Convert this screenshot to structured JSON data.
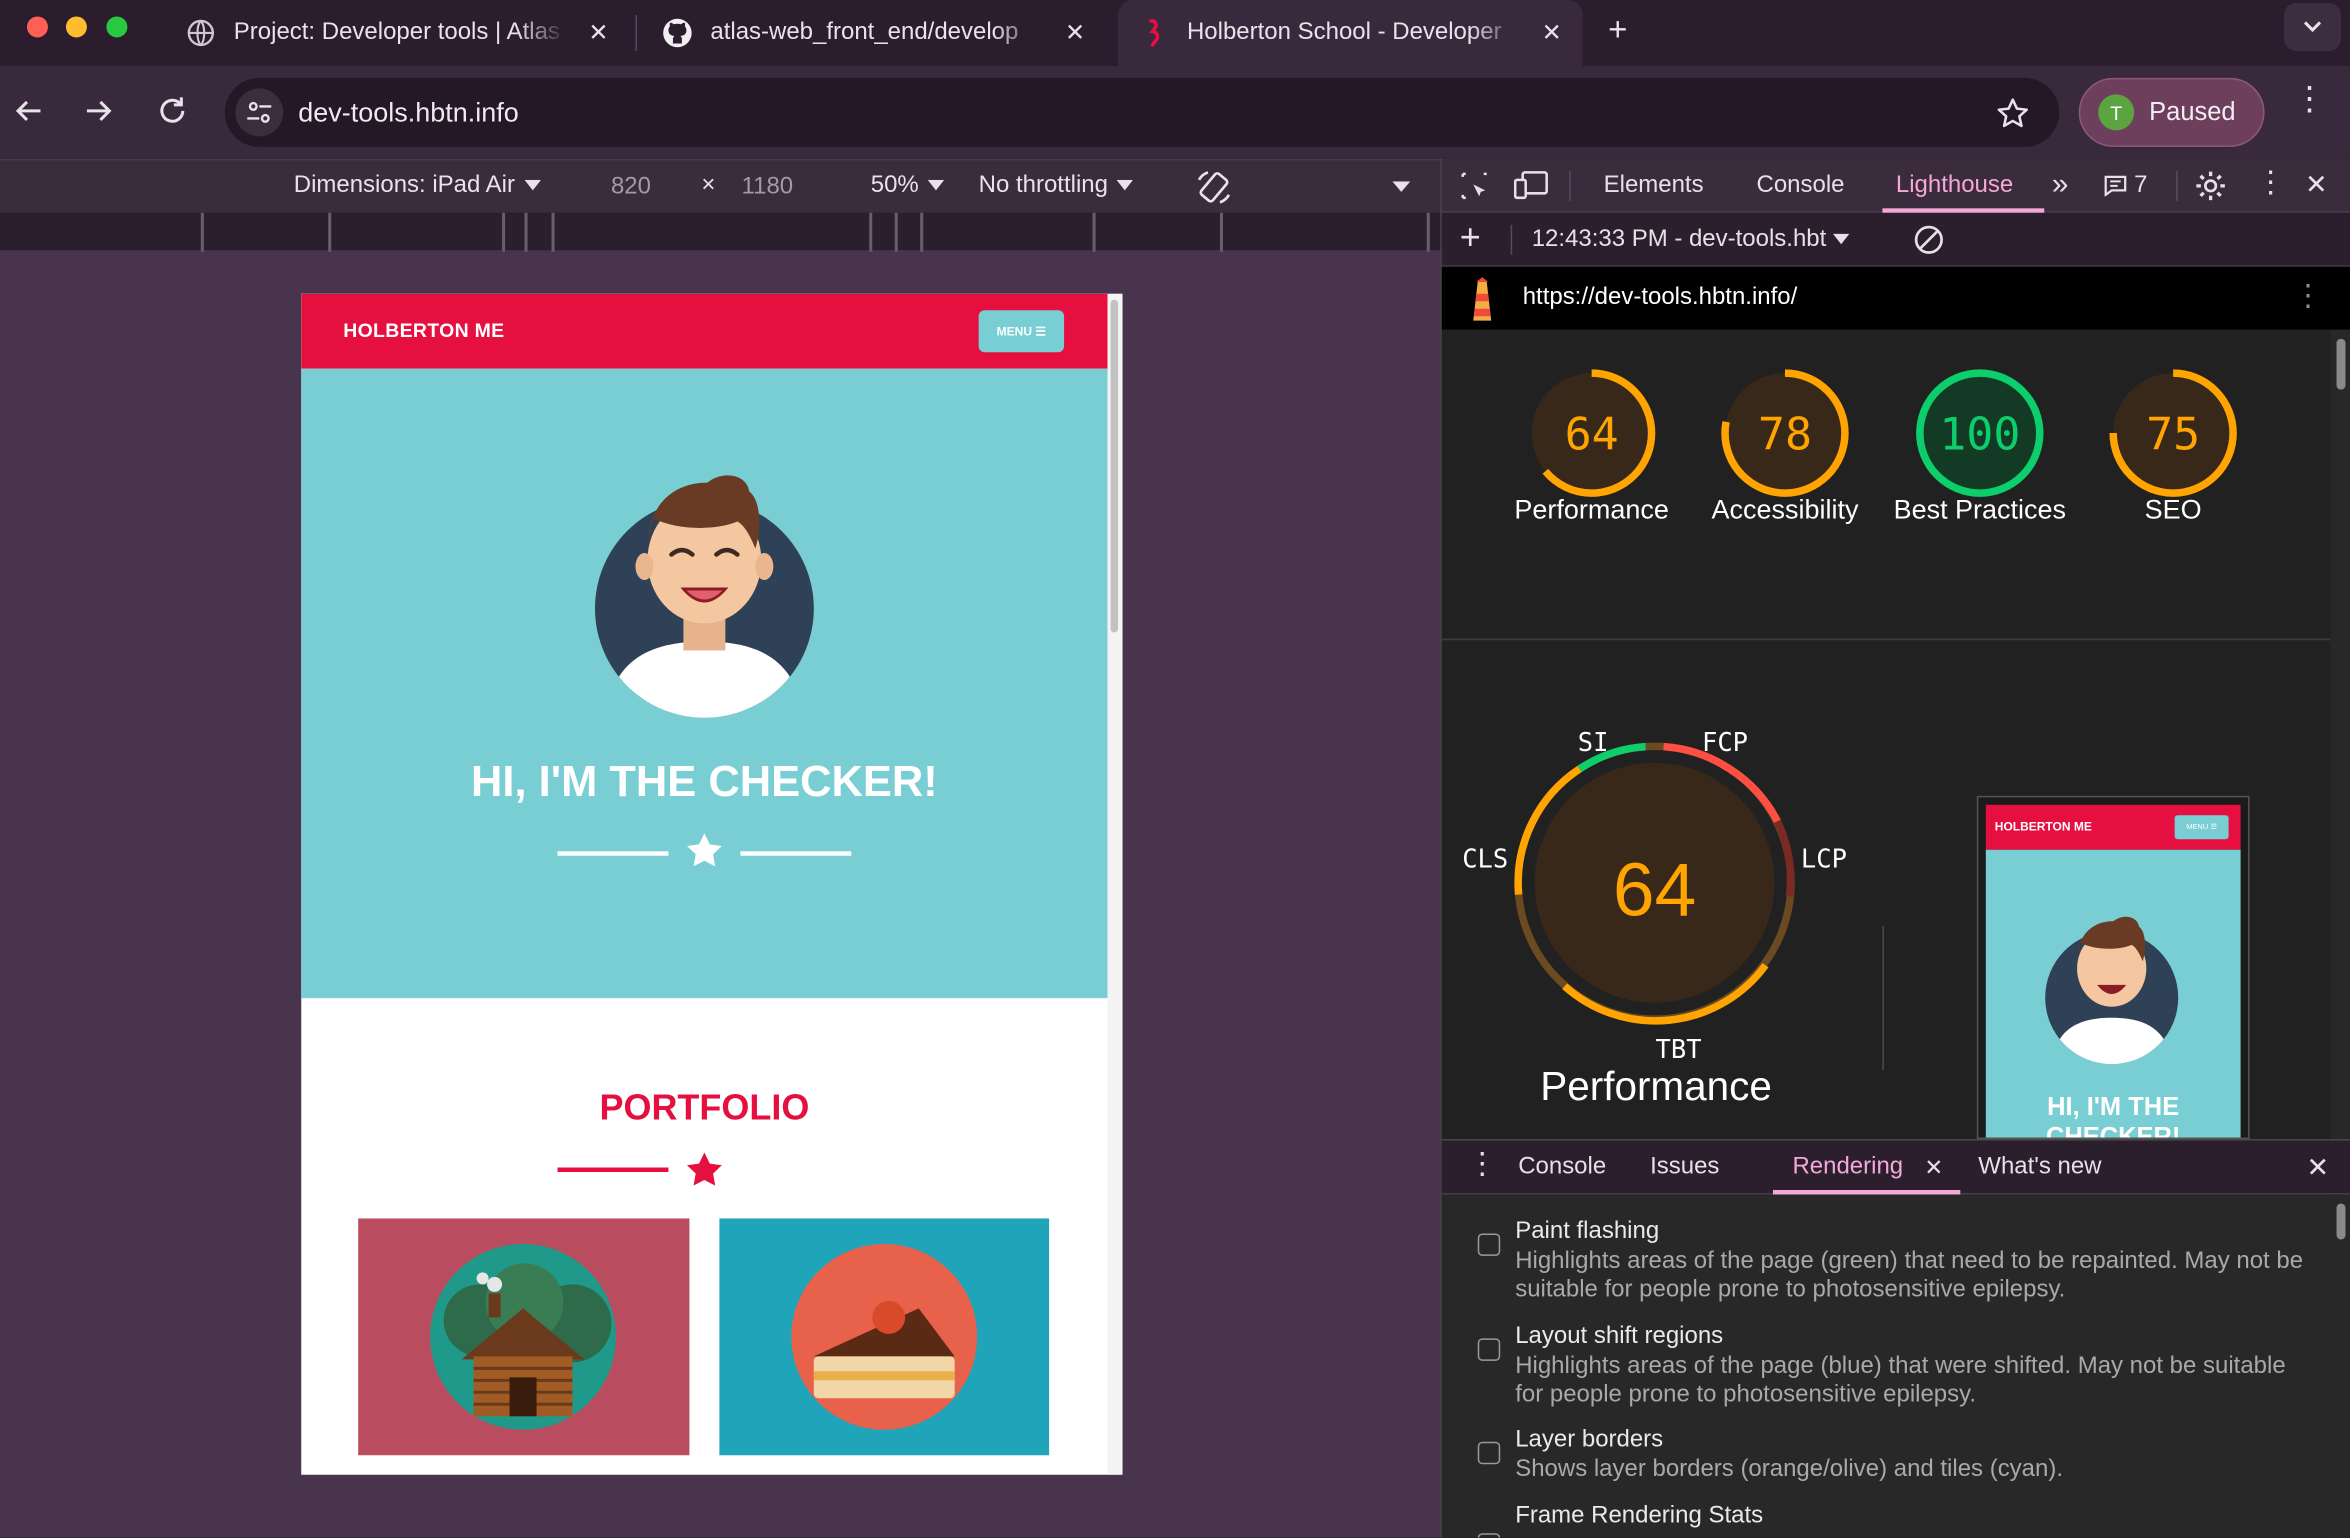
{
  "browser": {
    "tabs": [
      {
        "title": "Project: Developer tools | Atlas",
        "active": false
      },
      {
        "title": "atlas-web_front_end/develop",
        "active": false
      },
      {
        "title": "Holberton School - Developer",
        "active": true
      }
    ],
    "url": "dev-tools.hbtn.info",
    "profile": {
      "initial": "T",
      "label": "Paused"
    }
  },
  "device_toolbar": {
    "dimensions_label": "Dimensions: iPad Air",
    "width": "820",
    "times": "×",
    "height": "1180",
    "zoom": "50%",
    "throttling": "No throttling"
  },
  "emulated_page": {
    "brand": "HOLBERTON ME",
    "menu_button": "MENU ☰",
    "hero_title": "HI, I'M THE CHECKER!",
    "section_title": "PORTFOLIO",
    "colors": {
      "nav": "#e5103f",
      "hero": "#79ced3",
      "card1": "#b94c5f",
      "card2": "#1fa4b9"
    }
  },
  "devtools": {
    "tabs": [
      "Elements",
      "Console",
      "Lighthouse"
    ],
    "active_tab": "Lighthouse",
    "issues_count": "7",
    "report_selector": "12:43:33 PM - dev-tools.hbt",
    "report_url": "https://dev-tools.hbtn.info/",
    "scores": [
      {
        "value": "64",
        "label": "Performance",
        "score": 64,
        "color": "#ffa400"
      },
      {
        "value": "78",
        "label": "Accessibility",
        "score": 78,
        "color": "#ffa400"
      },
      {
        "value": "100",
        "label": "Best Practices",
        "score": 100,
        "color": "#0cce6b"
      },
      {
        "value": "75",
        "label": "SEO",
        "score": 75,
        "color": "#ffa400"
      }
    ],
    "perf_gauge": {
      "value": "64",
      "title": "Performance",
      "metrics": [
        "SI",
        "FCP",
        "LCP",
        "TBT",
        "CLS"
      ]
    },
    "thumbnail": {
      "brand": "HOLBERTON ME",
      "menu": "MENU ☰",
      "title": "HI, I'M THE CHECKER!"
    },
    "drawer": {
      "tabs": [
        "Console",
        "Issues",
        "Rendering",
        "What's new"
      ],
      "active_tab": "Rendering",
      "options": [
        {
          "title": "Paint flashing",
          "desc": "Highlights areas of the page (green) that need to be repainted. May not be suitable for people prone to photosensitive epilepsy."
        },
        {
          "title": "Layout shift regions",
          "desc": "Highlights areas of the page (blue) that were shifted. May not be suitable for people prone to photosensitive epilepsy."
        },
        {
          "title": "Layer borders",
          "desc": "Shows layer borders (orange/olive) and tiles (cyan)."
        },
        {
          "title": "Frame Rendering Stats",
          "desc": ""
        }
      ]
    }
  }
}
